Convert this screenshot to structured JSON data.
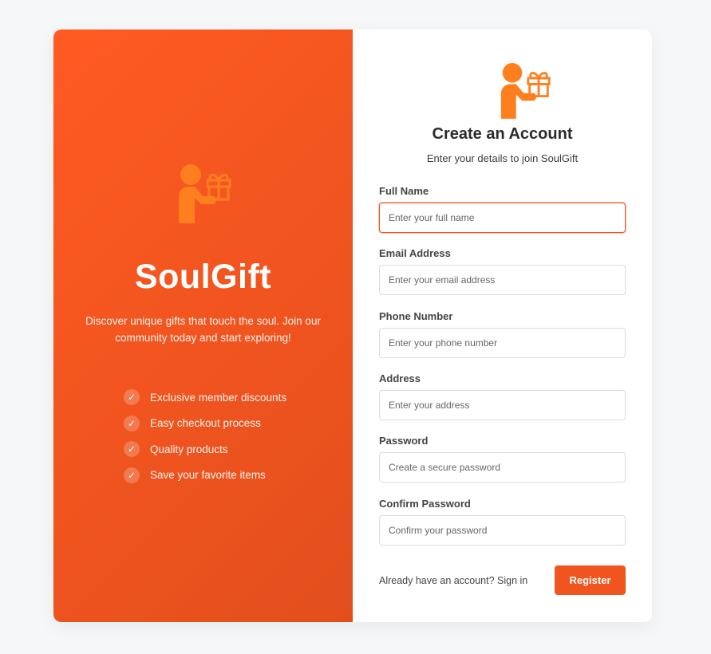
{
  "brand": {
    "name": "SoulGift",
    "tagline": "Discover unique gifts that touch the soul. Join our community today and start exploring!",
    "features": [
      "Exclusive member discounts",
      "Easy checkout process",
      "Quality products",
      "Save your favorite items"
    ],
    "icon": "person-with-gift-icon"
  },
  "form": {
    "title": "Create an Account",
    "subtitle": "Enter your details to join SoulGift",
    "fields": [
      {
        "label": "Full Name",
        "placeholder": "Enter your full name",
        "value": ""
      },
      {
        "label": "Email Address",
        "placeholder": "Enter your email address",
        "value": ""
      },
      {
        "label": "Phone Number",
        "placeholder": "Enter your phone number",
        "value": ""
      },
      {
        "label": "Address",
        "placeholder": "Enter your address",
        "value": ""
      },
      {
        "label": "Password",
        "placeholder": "Create a secure password",
        "value": ""
      },
      {
        "label": "Confirm Password",
        "placeholder": "Confirm your password",
        "value": ""
      }
    ],
    "signin_prompt": "Already have an account?",
    "signin_link": "Sign in",
    "register_label": "Register"
  },
  "colors": {
    "accent": "#f0541f",
    "panel_gradient_start": "#ff5a22",
    "panel_gradient_end": "#e24f1d",
    "icon_color": "#ff7f1f",
    "background": "#f6f7f9"
  }
}
